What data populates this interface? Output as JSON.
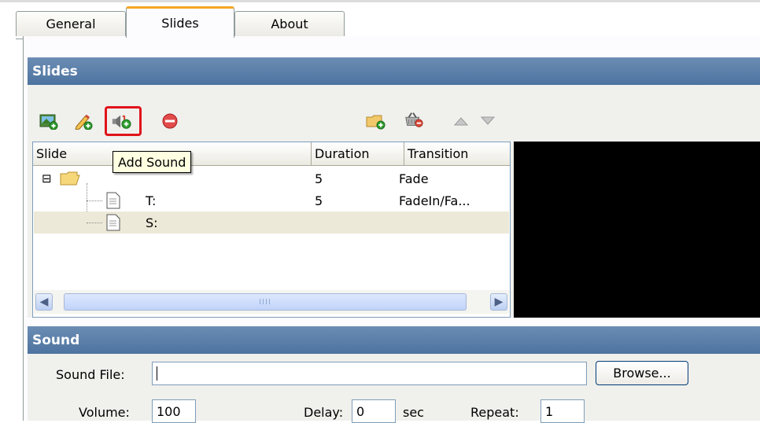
{
  "tabs": [
    {
      "label": "General",
      "active": false
    },
    {
      "label": "Slides",
      "active": true
    },
    {
      "label": "About",
      "active": false
    }
  ],
  "slides_section": {
    "title": "Slides",
    "toolbar": [
      {
        "name": "add-image-icon"
      },
      {
        "name": "edit-slide-icon"
      },
      {
        "name": "add-sound-icon",
        "highlighted": true
      },
      {
        "name": "remove-icon"
      },
      {
        "name": "add-folder-icon"
      },
      {
        "name": "delete-basket-icon"
      },
      {
        "name": "move-up-icon"
      },
      {
        "name": "move-down-icon"
      }
    ],
    "tooltip": "Add Sound",
    "columns": [
      "Slide",
      "Duration",
      "Transition"
    ],
    "rows": [
      {
        "type": "folder",
        "name": "",
        "duration": "5",
        "transition": "Fade"
      },
      {
        "type": "file",
        "name": "T:",
        "duration": "5",
        "transition": "FadeIn/Fa..."
      },
      {
        "type": "file",
        "name": "S:",
        "duration": "",
        "transition": "",
        "selected": true
      }
    ],
    "tree_toggle": "⊟"
  },
  "sound_section": {
    "title": "Sound",
    "sound_file_label": "Sound File:",
    "sound_file_value": "",
    "browse_label": "Browse...",
    "volume_label": "Volume:",
    "volume_value": "100",
    "delay_label": "Delay:",
    "delay_value": "0",
    "delay_unit": "sec",
    "repeat_label": "Repeat:",
    "repeat_value": "1"
  },
  "colors": {
    "section_header": "#5b7fab",
    "highlight": "#e0141a",
    "active_tab_accent": "#f5a623"
  }
}
